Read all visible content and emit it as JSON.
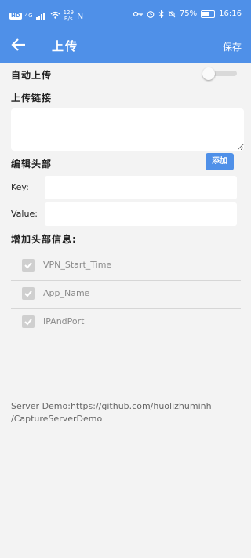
{
  "status_bar": {
    "hd": "HD",
    "net": "4G",
    "speed_value": "129",
    "speed_unit": "B/s",
    "battery_text": "75%",
    "battery_level": 0.75,
    "time": "16:16"
  },
  "app_bar": {
    "title": "上传",
    "save_label": "保存"
  },
  "auto_upload": {
    "label": "自动上传",
    "enabled": false
  },
  "upload_link": {
    "label": "上传链接",
    "value": ""
  },
  "edit_header": {
    "label": "编辑头部",
    "add_label": "添加"
  },
  "key_field": {
    "label": "Key:",
    "value": ""
  },
  "value_field": {
    "label": "Value:",
    "value": ""
  },
  "extra_header": {
    "label": "增加头部信息:",
    "items": [
      {
        "label": "VPN_Start_Time",
        "checked": true
      },
      {
        "label": "App_Name",
        "checked": true
      },
      {
        "label": "IPAndPort",
        "checked": true
      }
    ]
  },
  "footer": {
    "line1": "Server Demo:https://github.com/huolizhuminh",
    "line2": "/CaptureServerDemo"
  }
}
